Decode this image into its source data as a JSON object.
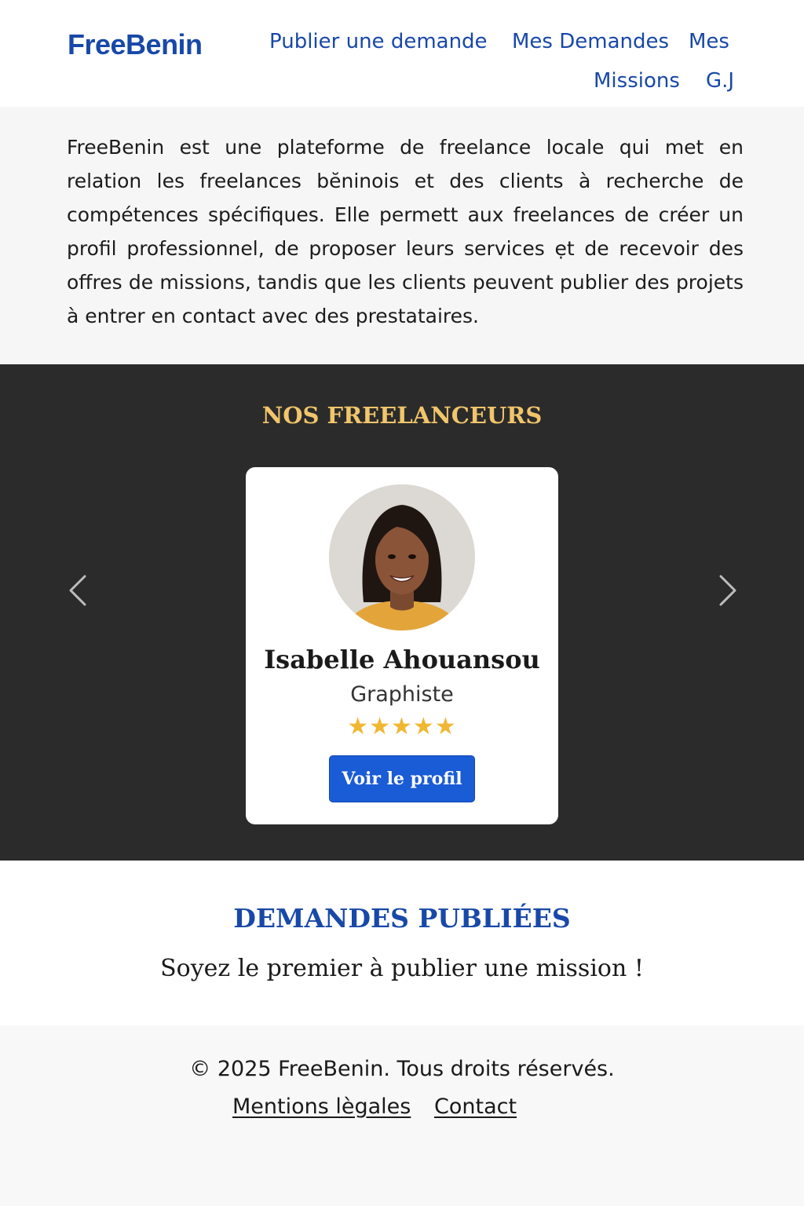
{
  "header": {
    "logo": "FreeBenin",
    "nav": [
      {
        "label": "Publier une demande"
      },
      {
        "label": "Mes Demandes"
      },
      {
        "label": "Mes"
      },
      {
        "label": "Missions"
      },
      {
        "label": "G.J"
      }
    ]
  },
  "intro": {
    "text": "FreeBenin est une plateforme de freelance locale qui met en relation les freelances bĕninois et des clients à recherche de compétences spécifiques. Elle permett aux freelances de créer un profil professionnel, de proposer leurs services ẹt de recevoir des offres de missions, tandis que les clients peuvent publier des projets à entrer en contact avec des prestataires."
  },
  "freelancers": {
    "title": "NOS FREELANCEURS",
    "card": {
      "name": "Isabelle Ahouansou",
      "role": "Graphiste",
      "rating": 5,
      "stars": "★★★★★",
      "button_label": "Voir le profil"
    },
    "prev_icon": "chevron-left-icon",
    "next_icon": "chevron-right-icon"
  },
  "demandes": {
    "title": "DEMANDES PUBLIÉES",
    "empty_message": "Soyez le premier à publier une mission !"
  },
  "footer": {
    "copyright": "© 2025 FreeBenin. Tous droits réservés.",
    "links": [
      {
        "label": "Mentions lègales"
      },
      {
        "label": "Contact"
      }
    ]
  },
  "colors": {
    "brand_blue": "#1848a8",
    "button_blue": "#1a5bd6",
    "gold": "#f1c56b",
    "dark_section": "#2b2b2b",
    "star": "#f0b733"
  }
}
